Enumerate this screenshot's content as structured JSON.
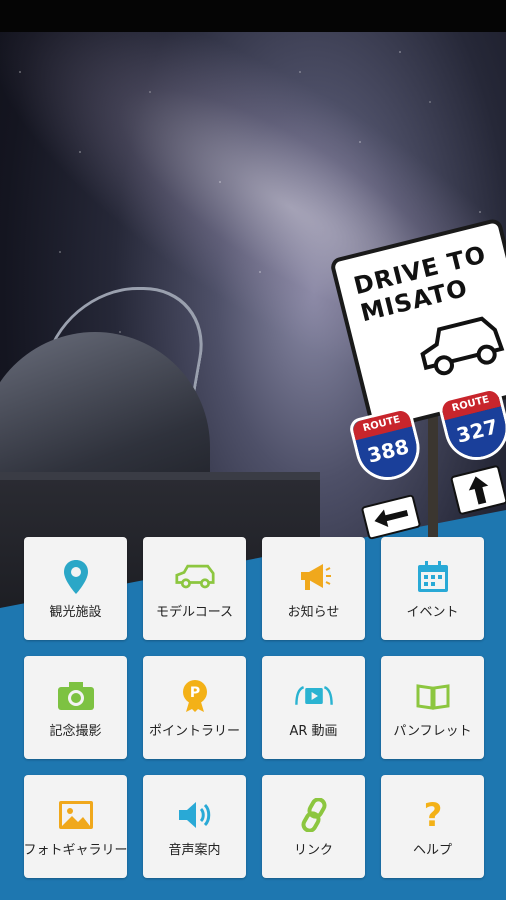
{
  "hero": {
    "sign_line1": "DRIVE TO",
    "sign_line2": "MISATO",
    "route_label_left": "ROUTE",
    "route_number_left": "388",
    "route_label_right": "ROUTE",
    "route_number_right": "327"
  },
  "menu": {
    "items": [
      {
        "label": "観光施設",
        "icon": "map-pin-icon",
        "color": "#2ba7c7"
      },
      {
        "label": "モデルコース",
        "icon": "car-icon",
        "color": "#8cc63f"
      },
      {
        "label": "お知らせ",
        "icon": "megaphone-icon",
        "color": "#f0a81c"
      },
      {
        "label": "イベント",
        "icon": "calendar-icon",
        "color": "#29a9d6"
      },
      {
        "label": "記念撮影",
        "icon": "camera-icon",
        "color": "#7dc242"
      },
      {
        "label": "ポイントラリー",
        "icon": "medal-icon",
        "color": "#f3b117"
      },
      {
        "label": "AR 動画",
        "icon": "ar-video-icon",
        "color": "#2ab3d1"
      },
      {
        "label": "パンフレット",
        "icon": "book-icon",
        "color": "#8cc63f"
      },
      {
        "label": "フォトギャラリー",
        "icon": "picture-icon",
        "color": "#f0a81c"
      },
      {
        "label": "音声案内",
        "icon": "speaker-icon",
        "color": "#29a9d6"
      },
      {
        "label": "リンク",
        "icon": "link-icon",
        "color": "#8cc63f"
      },
      {
        "label": "ヘルプ",
        "icon": "question-icon",
        "color": "#f3b117"
      }
    ]
  }
}
